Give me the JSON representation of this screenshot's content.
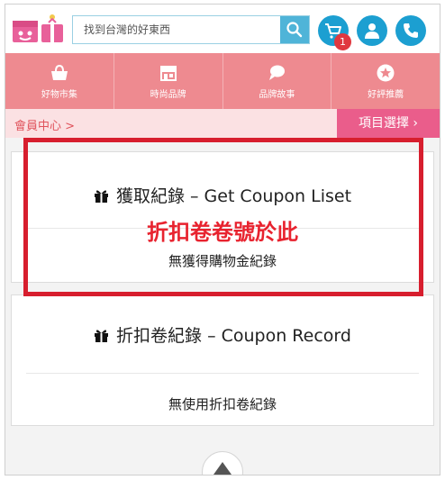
{
  "header": {
    "search": {
      "placeholder": "找到台灣的好東西",
      "value": ""
    },
    "icons": {
      "logo": "gift-box-logo",
      "search": "search-icon",
      "cart": "cart-icon",
      "member": "user-icon",
      "phone": "phone-icon"
    },
    "cart_count": "1"
  },
  "nav": {
    "items": [
      {
        "label": "好物市集",
        "icon": "basket-icon"
      },
      {
        "label": "時尚品牌",
        "icon": "storefront-icon"
      },
      {
        "label": "品牌故事",
        "icon": "chat-bubble-icon"
      },
      {
        "label": "好評推薦",
        "icon": "star-badge-icon"
      }
    ]
  },
  "breadcrumb": {
    "label": "會員中心 >"
  },
  "select_button": {
    "label": "項目選擇 ›"
  },
  "cards": [
    {
      "title": "獲取紀錄 – Get Coupon Liset",
      "empty": "無獲得購物金紀錄"
    },
    {
      "title": "折扣卷紀錄 – Coupon Record",
      "empty": "無使用折扣卷紀錄"
    }
  ],
  "annotation": {
    "text": "折扣卷卷號於此"
  },
  "colors": {
    "accent": "#ee8a90",
    "brand_blue": "#1c9fd1",
    "highlight": "#d71e2e",
    "select_pink": "#ea5d8b"
  }
}
